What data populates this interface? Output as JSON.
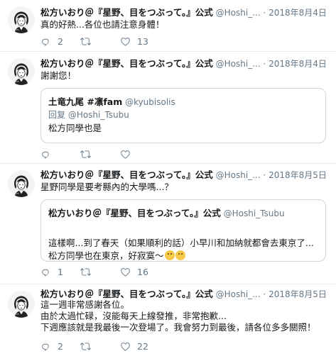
{
  "tweets": [
    {
      "name": "松方いおり＠『星野、目をつぶって。』公式",
      "handle": "@Hoshi_...",
      "dot": "·",
      "date": "2018年8月4日",
      "text": "真的好熱...各位也請注意身體！",
      "replies": "2",
      "retweets": "",
      "likes": "13"
    },
    {
      "name": "松方いおり＠『星野、目をつぶって。』公式",
      "handle": "@Hoshi_...",
      "dot": "·",
      "date": "2018年8月4日",
      "text": "謝謝您！",
      "quote": {
        "name": "土竜九尾 #凛fam",
        "handle": "@kyubisolis",
        "reply_to": "回复 @Hoshi_Tsubu",
        "text": "松方同學也是"
      },
      "replies": "",
      "retweets": "",
      "likes": ""
    },
    {
      "name": "松方いおり＠『星野、目をつぶって。』公式",
      "handle": "@Hoshi_...",
      "dot": "·",
      "date": "2018年8月5日",
      "text": "星野同學是要考縣內的大學嗎...？",
      "quote": {
        "name": "松方いおり＠『星野、目をつぶって。』公式",
        "handle": "@Hoshi_Tsubu",
        "text": "這樣啊...到了春天（如果順利的話）小早川和加納就都會去東京了...\n松方同學也在東京，好寂寞～"
      },
      "replies": "1",
      "retweets": "",
      "likes": "16"
    },
    {
      "name": "松方いおり＠『星野、目をつぶって。』公式",
      "handle": "@Hoshi_...",
      "dot": "·",
      "date": "2018年8月5日",
      "text": "這一週非常感謝各位。\n由於太過忙碌，沒能每天上線發推，非常抱歉...\n下週應該就是我最後一次登場了。我會努力到最後，請各位多多關照！",
      "replies": "2",
      "retweets": "",
      "likes": "22"
    }
  ],
  "icons": {
    "reply": "reply-icon",
    "retweet": "retweet-icon",
    "like": "heart-icon",
    "avatar": "avatar"
  },
  "colors": {
    "text": "#14171a",
    "muted": "#657786",
    "border": "#e6ecf0",
    "quote_border": "#ccd6dd"
  }
}
